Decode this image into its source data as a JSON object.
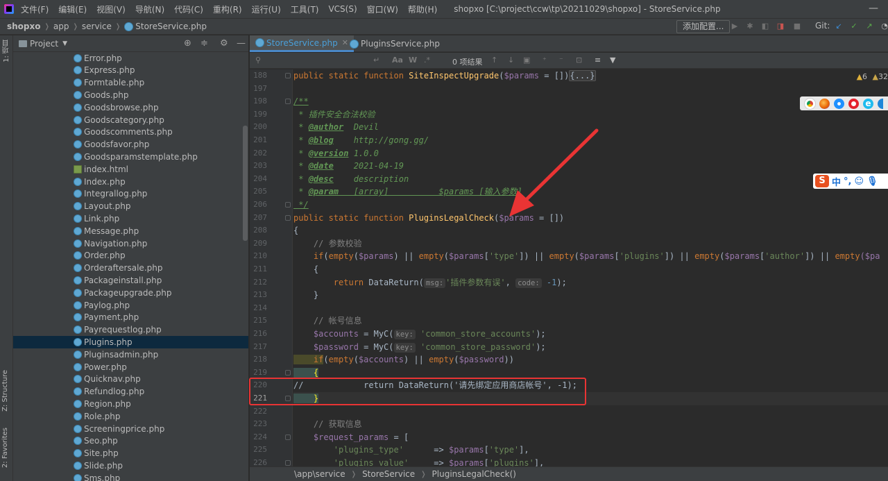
{
  "menu": {
    "items": [
      "文件(F)",
      "编辑(E)",
      "视图(V)",
      "导航(N)",
      "代码(C)",
      "重构(R)",
      "运行(U)",
      "工具(T)",
      "VCS(S)",
      "窗口(W)",
      "帮助(H)"
    ],
    "window_title": "shopxo [C:\\project\\ccw\\tp\\20211029\\shopxo] - StoreService.php"
  },
  "navbar": {
    "breadcrumb": [
      "shopxo",
      "app",
      "service",
      "StoreService.php"
    ],
    "run_config_label": "添加配置...",
    "git_label": "Git:"
  },
  "left_strip": {
    "project_tab": "1: 项目",
    "structure_tab": "Z: Structure",
    "favorites_tab": "2: Favorites"
  },
  "project_panel": {
    "title": "Project",
    "files": [
      {
        "name": "Error.php",
        "type": "php"
      },
      {
        "name": "Express.php",
        "type": "php"
      },
      {
        "name": "Formtable.php",
        "type": "php"
      },
      {
        "name": "Goods.php",
        "type": "php"
      },
      {
        "name": "Goodsbrowse.php",
        "type": "php"
      },
      {
        "name": "Goodscategory.php",
        "type": "php"
      },
      {
        "name": "Goodscomments.php",
        "type": "php"
      },
      {
        "name": "Goodsfavor.php",
        "type": "php"
      },
      {
        "name": "Goodsparamstemplate.php",
        "type": "php"
      },
      {
        "name": "index.html",
        "type": "html"
      },
      {
        "name": "Index.php",
        "type": "php"
      },
      {
        "name": "Integrallog.php",
        "type": "php"
      },
      {
        "name": "Layout.php",
        "type": "php"
      },
      {
        "name": "Link.php",
        "type": "php"
      },
      {
        "name": "Message.php",
        "type": "php"
      },
      {
        "name": "Navigation.php",
        "type": "php"
      },
      {
        "name": "Order.php",
        "type": "php"
      },
      {
        "name": "Orderaftersale.php",
        "type": "php"
      },
      {
        "name": "Packageinstall.php",
        "type": "php"
      },
      {
        "name": "Packageupgrade.php",
        "type": "php"
      },
      {
        "name": "Paylog.php",
        "type": "php"
      },
      {
        "name": "Payment.php",
        "type": "php"
      },
      {
        "name": "Payrequestlog.php",
        "type": "php"
      },
      {
        "name": "Plugins.php",
        "type": "php",
        "selected": true
      },
      {
        "name": "Pluginsadmin.php",
        "type": "php"
      },
      {
        "name": "Power.php",
        "type": "php"
      },
      {
        "name": "Quicknav.php",
        "type": "php"
      },
      {
        "name": "Refundlog.php",
        "type": "php"
      },
      {
        "name": "Region.php",
        "type": "php"
      },
      {
        "name": "Role.php",
        "type": "php"
      },
      {
        "name": "Screeningprice.php",
        "type": "php"
      },
      {
        "name": "Seo.php",
        "type": "php"
      },
      {
        "name": "Site.php",
        "type": "php"
      },
      {
        "name": "Slide.php",
        "type": "php"
      },
      {
        "name": "Sms.php",
        "type": "php"
      }
    ]
  },
  "tabs": [
    {
      "label": "StoreService.php",
      "active": true
    },
    {
      "label": "PluginsService.php",
      "active": false
    }
  ],
  "find": {
    "results": "0 项结果",
    "match_case": "Aa",
    "words": "W",
    "regex": ".*"
  },
  "inspection": {
    "warnings": "6",
    "weak": "32"
  },
  "ime": {
    "logo": "S",
    "lang": "中",
    "punct": "°,"
  },
  "editor": {
    "line_numbers": [
      "188",
      "197",
      "198",
      "199",
      "200",
      "201",
      "202",
      "203",
      "204",
      "205",
      "206",
      "207",
      "208",
      "209",
      "210",
      "211",
      "212",
      "213",
      "214",
      "215",
      "216",
      "217",
      "218",
      "219",
      "220",
      "221",
      "222",
      "223",
      "224",
      "225",
      "226"
    ],
    "current_line": "221",
    "code": {
      "l188_kw": "public static function ",
      "l188_fn": "SiteInspectUpgrade",
      "l188_p1": "(",
      "l188_var": "$params",
      "l188_p2": " = [])",
      "l188_fold": "{...}",
      "l198": "/**",
      "l199": " * 插件安全合法校验",
      "l200_star": " * ",
      "l200_tag": "@author",
      "l200_val": "  Devil",
      "l201_star": " * ",
      "l201_tag": "@blog",
      "l201_val": "    http://gong.gg/",
      "l202_star": " * ",
      "l202_tag": "@version",
      "l202_val": " 1.0.0",
      "l203_star": " * ",
      "l203_tag": "@date",
      "l203_val": "    2021-04-19",
      "l204_star": " * ",
      "l204_tag": "@desc",
      "l204_val": "    description",
      "l205_star": " * ",
      "l205_tag": "@param",
      "l205_val": "   [array]          $params [输入参数]",
      "l206": " */",
      "l207_kw": "public static function ",
      "l207_fn": "PluginsLegalCheck",
      "l207_p1": "(",
      "l207_var": "$params",
      "l207_p2": " = [])",
      "l208": "{",
      "l209": "    // 参数校验",
      "l210_a": "    if",
      "l210_b": "(",
      "l210_c": "empty",
      "l210_d": "(",
      "l210_e": "$params",
      "l210_f": ") || ",
      "l210_g": "empty",
      "l210_h": "(",
      "l210_i": "$params",
      "l210_j": "[",
      "l210_k": "'type'",
      "l210_l": "]) || ",
      "l210_m": "empty",
      "l210_n": "(",
      "l210_o": "$params",
      "l210_p": "[",
      "l210_q": "'plugins'",
      "l210_r": "]) || ",
      "l210_s": "empty",
      "l210_t": "(",
      "l210_u": "$params",
      "l210_v": "[",
      "l210_w": "'author'",
      "l210_x": "]) || ",
      "l210_y": "empty",
      "l210_z": "($pa",
      "l211": "    {",
      "l212_a": "        return ",
      "l212_b": "DataReturn(",
      "l212_hint1": "msg:",
      "l212_s": "'插件参数有误'",
      "l212_c": ", ",
      "l212_hint2": "code:",
      "l212_n": " -1",
      "l212_d": ");",
      "l213": "    }",
      "l215": "    // 帐号信息",
      "l216_v": "    $accounts",
      "l216_a": " = MyC(",
      "l216_hint": "key:",
      "l216_s": " 'common_store_accounts'",
      "l216_b": ");",
      "l217_v": "    $password",
      "l217_a": " = MyC(",
      "l217_hint": "key:",
      "l217_s": " 'common_store_password'",
      "l217_b": ");",
      "l218_a": "    if",
      "l218_b": "(",
      "l218_c": "empty",
      "l218_d": "(",
      "l218_e": "$accounts",
      "l218_f": ") || ",
      "l218_g": "empty",
      "l218_h": "(",
      "l218_i": "$password",
      "l218_j": "))",
      "l219": "    {",
      "l220_cm": "//            return DataReturn('请先绑定应用商店帐号', -1);",
      "l221": "    }",
      "l223": "    // 获取信息",
      "l224_v": "    $request_params",
      "l224_a": " = [",
      "l225_s": "        'plugins_type'",
      "l225_a": "      => ",
      "l225_v": "$params",
      "l225_b": "[",
      "l225_s2": "'type'",
      "l225_c": "],",
      "l226_s": "        'plugins_value'",
      "l226_a": "     => ",
      "l226_v": "$params",
      "l226_b": "[",
      "l226_s2": "'plugins'",
      "l226_c": "],"
    }
  },
  "statusbar": {
    "crumbs": [
      "\\app\\service",
      "StoreService",
      "PluginsLegalCheck()"
    ]
  },
  "colors": {
    "accent_tab": "#4a88c7",
    "annotation_red": "#e93434",
    "selection": "#0d293e"
  }
}
